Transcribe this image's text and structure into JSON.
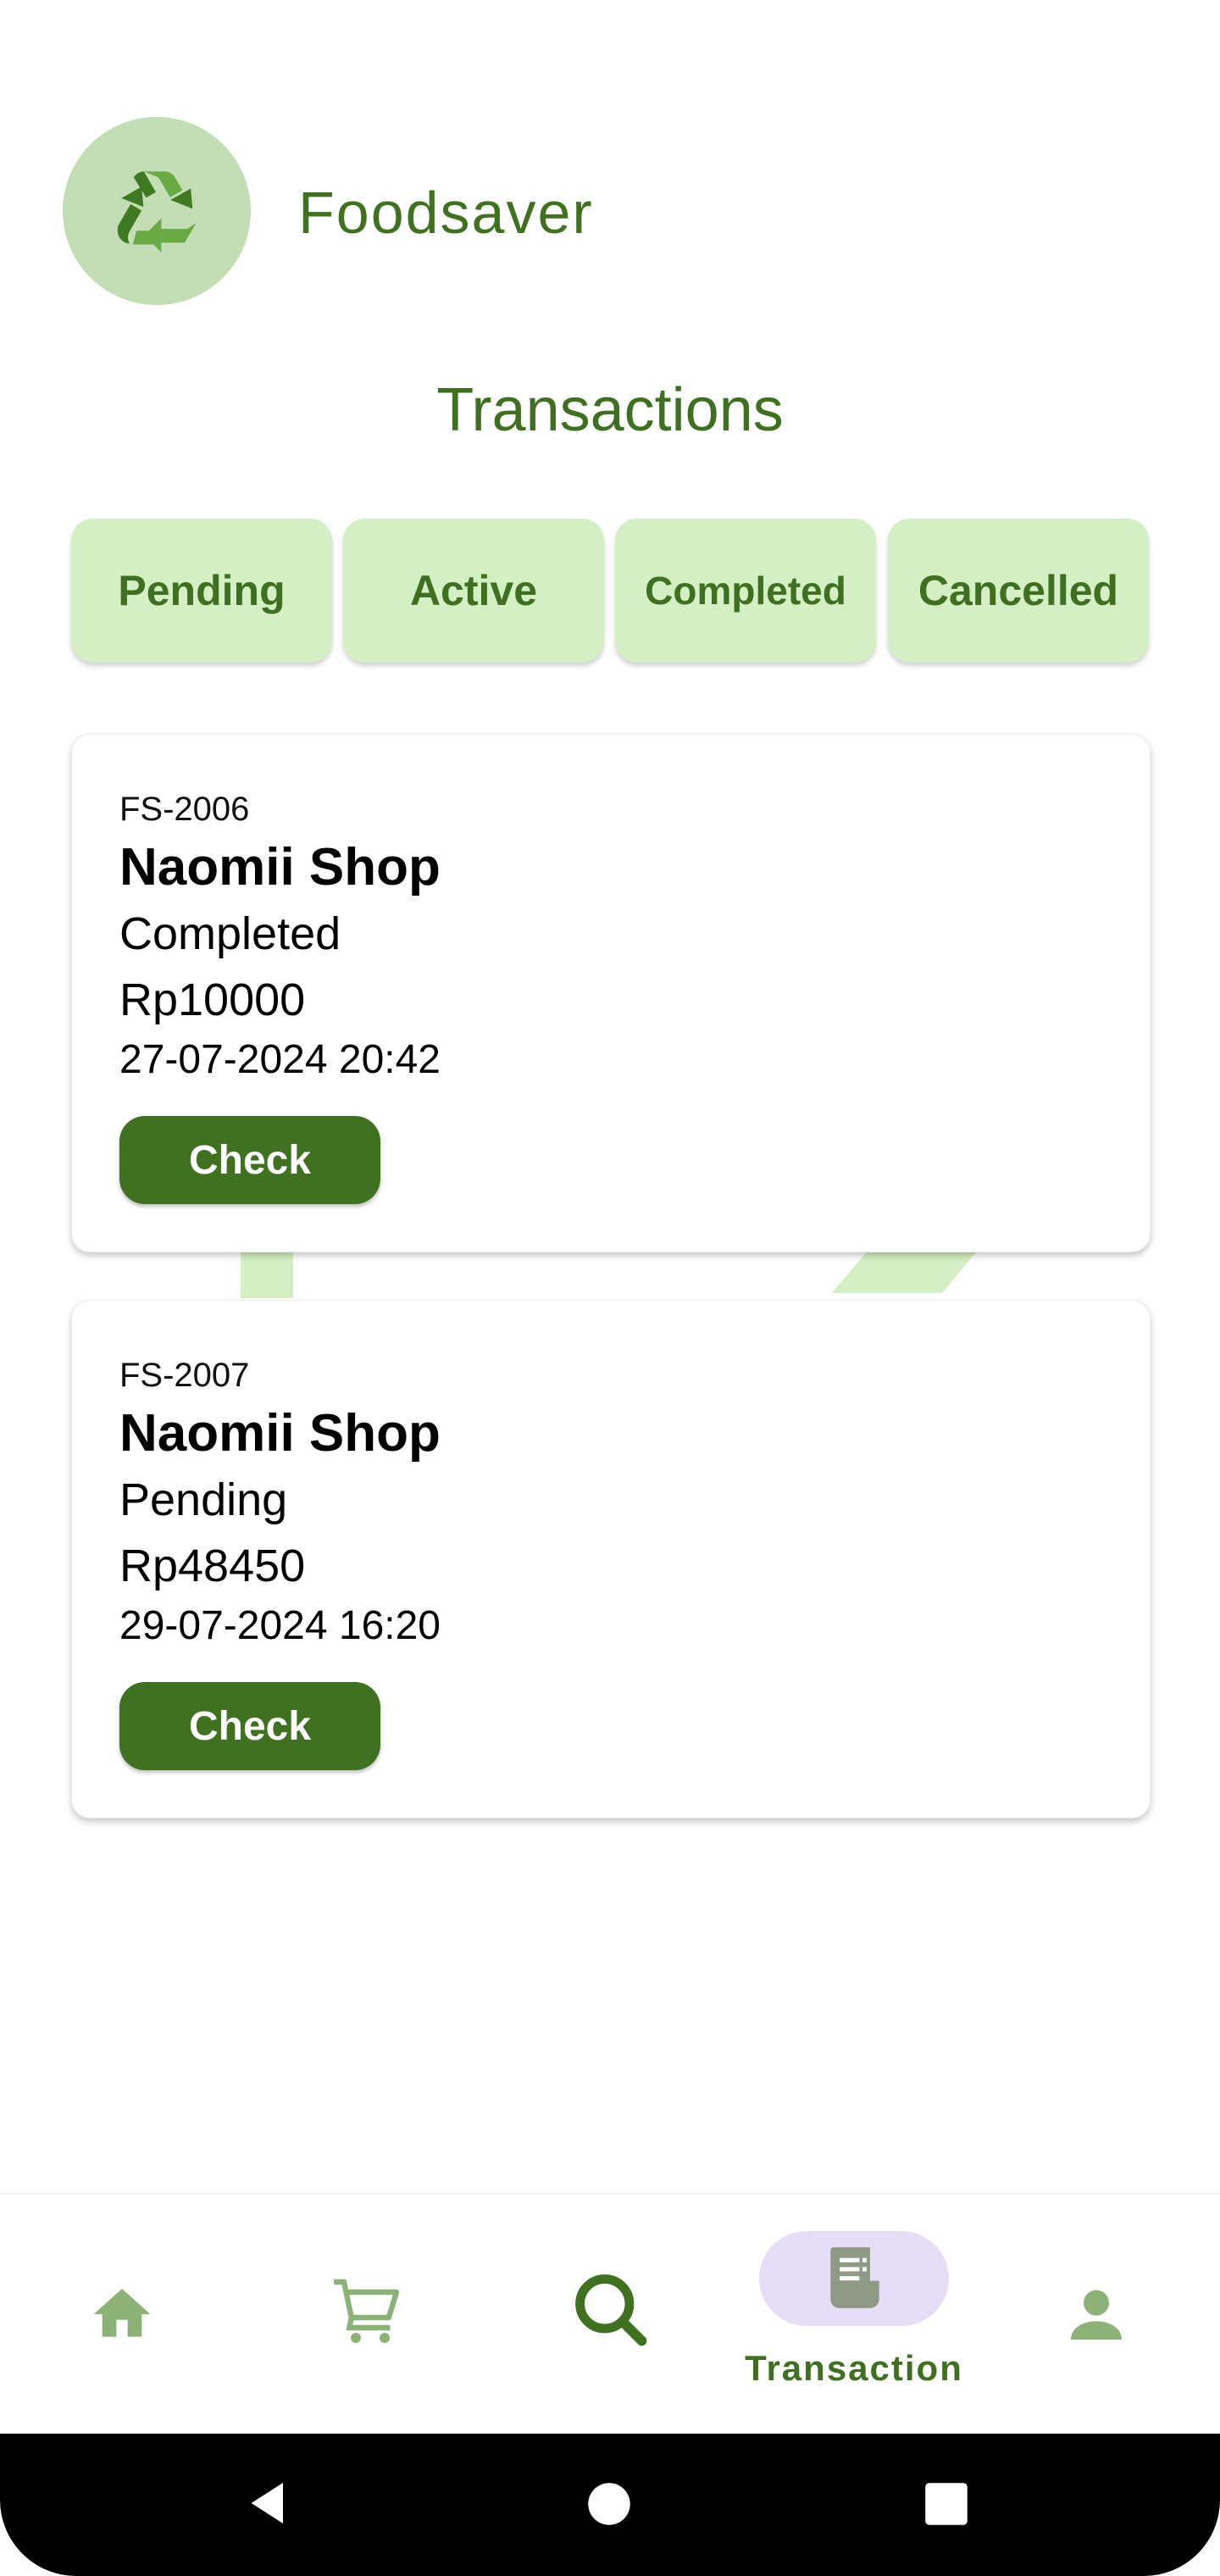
{
  "app": {
    "name": "Foodsaver"
  },
  "page": {
    "title": "Transactions"
  },
  "tabs": [
    {
      "label": "Pending"
    },
    {
      "label": "Active"
    },
    {
      "label": "Completed"
    },
    {
      "label": "Cancelled"
    }
  ],
  "transactions": [
    {
      "id": "FS-2006",
      "shop": "Naomii Shop",
      "status": "Completed",
      "price": "Rp10000",
      "date": "27-07-2024 20:42",
      "action": "Check"
    },
    {
      "id": "FS-2007",
      "shop": "Naomii Shop",
      "status": "Pending",
      "price": "Rp48450",
      "date": "29-07-2024 16:20",
      "action": "Check"
    }
  ],
  "bottom_nav": {
    "items": [
      {
        "icon": "home-icon"
      },
      {
        "icon": "cart-icon"
      },
      {
        "icon": "search-icon"
      },
      {
        "icon": "receipt-icon",
        "label": "Transaction",
        "active": true
      },
      {
        "icon": "person-icon"
      }
    ]
  },
  "system_nav": {
    "icons": [
      "back-icon",
      "home-circle-icon",
      "recents-icon"
    ]
  },
  "colors": {
    "primary": "#3f7120",
    "tab_bg": "#d4efc3",
    "logo_bg": "#c3ddb4",
    "nav_active_pill": "#e6def6"
  }
}
